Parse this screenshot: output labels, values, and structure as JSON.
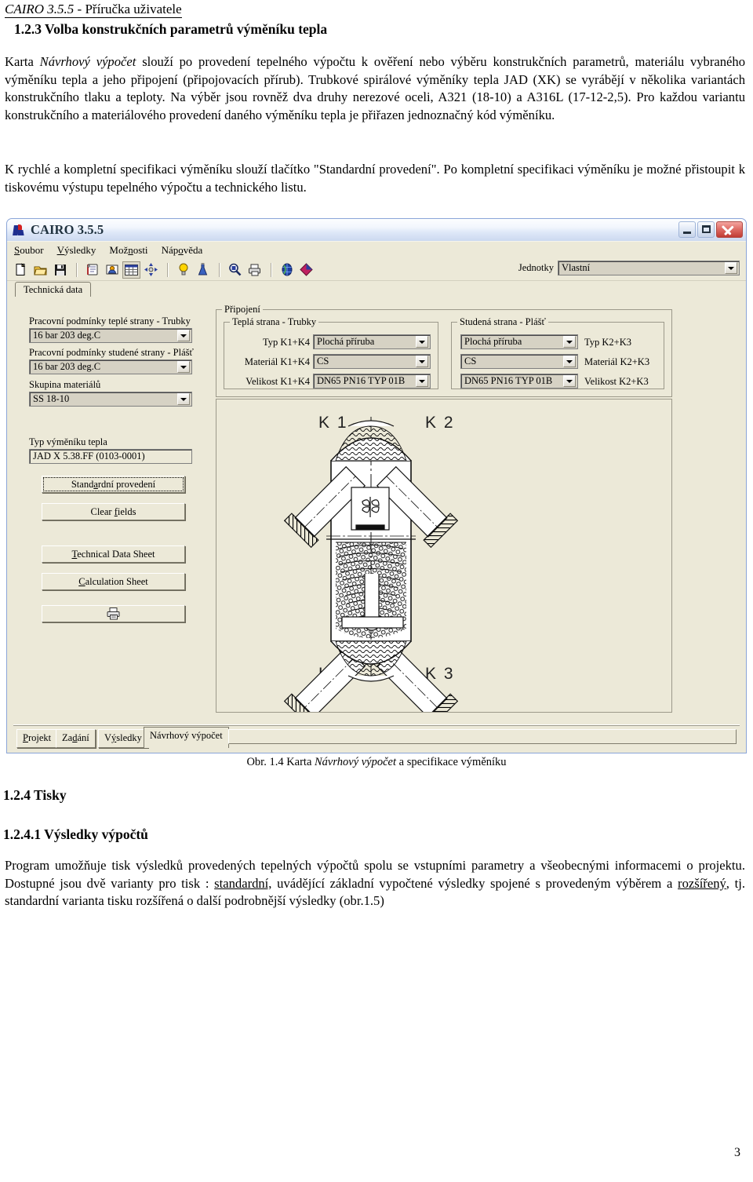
{
  "document": {
    "running_head_title": "CAIRO 3.5.5",
    "running_head_rest": "  - Příručka uživatele",
    "section_123": "1.2.3 Volba konstrukčních parametrů výměníku tepla",
    "para1_a": "Karta ",
    "para1_ital": "Návrhový výpočet",
    "para1_b": " slouží po provedení tepelného výpočtu k ověření nebo výběru konstrukčních parametrů, materiálu vybraného výměníku tepla a jeho připojení (připojovacích přírub). Trubkové spirálové výměníky tepla JAD (XK) se vyrábějí v několika variantách konstrukčního tlaku a teploty. Na výběr jsou rovněž dva druhy nerezové oceli, A321 (18-10) a A316L (17-12-2,5). Pro každou variantu konstrukčního a materiálového provedení daného výměníku tepla je přiřazen jednoznačný kód výměníku.",
    "para2": "K rychlé a kompletní specifikaci výměníku slouží tlačítko \"Standardní provedení\". Po kompletní specifikaci výměníku je možné přistoupit k tiskovému výstupu tepelného výpočtu a technického listu.",
    "figure_caption_a": "Obr. 1.4 Karta ",
    "figure_caption_ital": "Návrhový výpočet",
    "figure_caption_b": " a specifikace výměníku",
    "section_124": "1.2.4 Tisky",
    "section_1241": "1.2.4.1 Výsledky výpočtů",
    "para3_a": "Program umožňuje tisk výsledků provedených tepelných výpočtů spolu se vstupními parametry a všeobecnými informacemi o projektu. Dostupné jsou dvě varianty pro tisk : ",
    "para3_u1": "standardní,",
    "para3_b": " uvádějící základní vypočtené výsledky spojené s provedeným výběrem a ",
    "para3_u2": "rozšířený",
    "para3_c": ", tj. standardní varianta tisku rozšířená o další podrobnější výsledky (obr.1.5)",
    "page_number": "3"
  },
  "app": {
    "title": "CAIRO 3.5.5",
    "window_buttons": {
      "minimize": "minimize-button",
      "maximize": "maximize-button",
      "close": "close-button"
    },
    "menu": [
      {
        "label": "Soubor",
        "acc": "S",
        "rest": "oubor"
      },
      {
        "label": "Výsledky",
        "acc": "V",
        "rest": "ýsledky"
      },
      {
        "label": "Možnosti",
        "pre": "Mož",
        "acc": "n",
        "rest": "osti"
      },
      {
        "label": "Nápověda",
        "pre": "Náp",
        "acc": "o",
        "rest": "věda"
      }
    ],
    "toolbar": {
      "icons": [
        "new-document-icon",
        "open-folder-icon",
        "save-disk-icon",
        "notebook-icon",
        "contacts-icon",
        "table-grid-icon",
        "move-arrows-icon",
        "lightbulb-icon",
        "flask-icon",
        "zoom-search-icon",
        "print-preview-icon",
        "globe-icon",
        "diamond-icon"
      ],
      "units_label": "Jednotky",
      "units_value": "Vlastní"
    },
    "top_tab": "Technická data",
    "left_panel": {
      "hot_side_label": "Pracovní podmínky teplé strany - Trubky",
      "hot_side_value": "16 bar 203 deg.C",
      "cold_side_label": "Pracovní podmínky studené strany - Plášť",
      "cold_side_value": "16 bar 203 deg.C",
      "material_group_label": "Skupina materiálů",
      "material_group_value": "SS 18-10",
      "exchanger_type_label": "Typ výměníku tepla",
      "exchanger_type_value": "JAD X 5.38.FF (0103-0001)",
      "buttons": [
        {
          "pre": "Stand",
          "acc": "a",
          "rest": "rdní provedení",
          "name": "standard-design-button"
        },
        {
          "pre": "Clear ",
          "acc": "f",
          "rest": "ields",
          "name": "clear-fields-button"
        },
        {
          "pre": "",
          "acc": "T",
          "rest": "echnical Data Sheet",
          "name": "technical-data-sheet-button"
        },
        {
          "pre": "",
          "acc": "C",
          "rest": "alculation Sheet",
          "name": "calculation-sheet-button"
        }
      ],
      "print_button_icon": "printer-icon"
    },
    "connection_group": {
      "title": "Připojení",
      "hot": {
        "title": "Teplá strana - Trubky",
        "rows": [
          {
            "label": "Typ K1+K4",
            "value": "Plochá příruba"
          },
          {
            "label": "Materiál K1+K4",
            "value": "CS"
          },
          {
            "label": "Velikost K1+K4",
            "value": "DN65 PN16 TYP 01B"
          }
        ]
      },
      "cold": {
        "title": "Studená strana - Plášť",
        "rows": [
          {
            "label": "Typ K2+K3",
            "value": "Plochá příruba"
          },
          {
            "label": "Materiál K2+K3",
            "value": "CS"
          },
          {
            "label": "Velikost K2+K3",
            "value": "DN65 PN16 TYP 01B"
          }
        ]
      }
    },
    "drawing": {
      "labels": [
        "K 1",
        "K 2",
        "K 4",
        "K 3"
      ]
    },
    "bottom_tabs": [
      {
        "pre": "",
        "acc": "P",
        "rest": "rojekt",
        "active": false
      },
      {
        "pre": "Za",
        "acc": "d",
        "rest": "ání",
        "active": false
      },
      {
        "pre": "V",
        "acc": "ý",
        "rest": "sledky",
        "active": false
      },
      {
        "pre": "Návrhový výpočet",
        "acc": "",
        "rest": "",
        "active": true
      }
    ]
  },
  "colors": {
    "window_face": "#ece9d8",
    "title_gradient_start": "#fdfeff",
    "title_gradient_end": "#ccd9f0",
    "close_button": "#c03c34",
    "field_bg": "#d6d2c4",
    "drawing_ink": "#000000"
  }
}
